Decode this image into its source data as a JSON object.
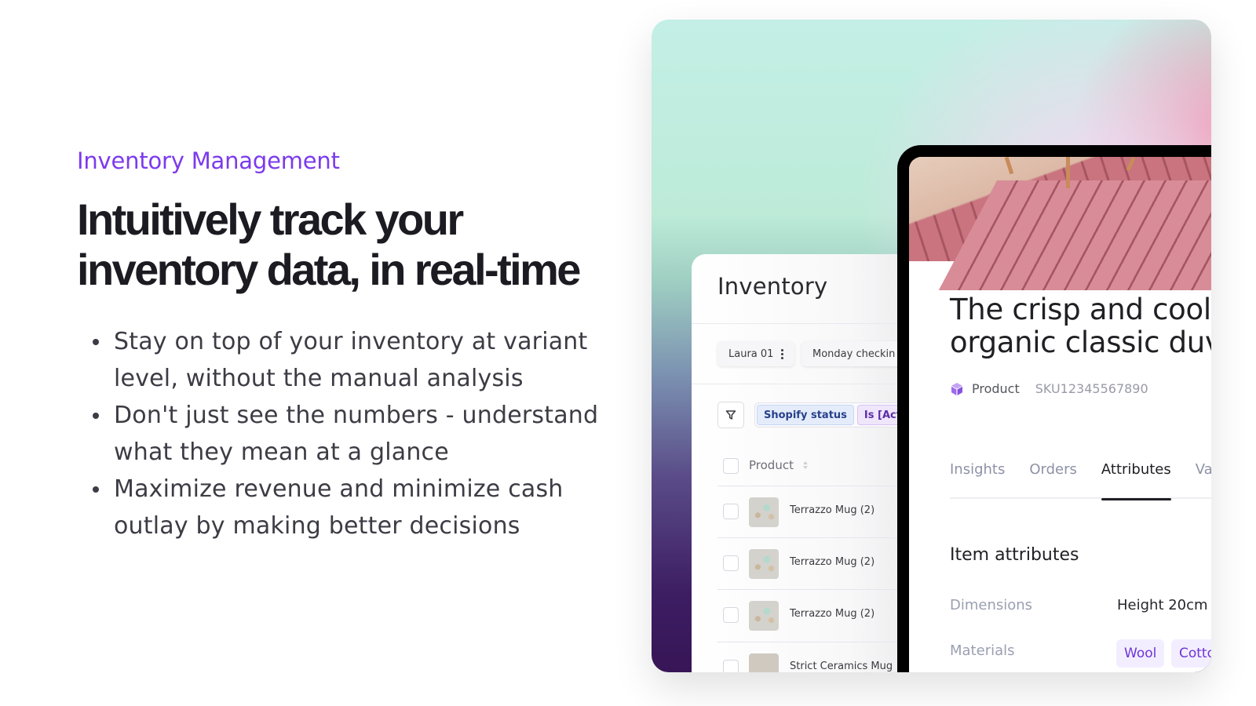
{
  "hero": {
    "eyebrow": "Inventory Management",
    "headline_line1": "Intuitively track your",
    "headline_line2": "inventory data, in real-time",
    "bullets": [
      {
        "line1": "Stay on top of your inventory at variant",
        "line2": "level, without the manual analysis"
      },
      {
        "line1": "Don't just see the numbers - understand",
        "line2": "what they mean at a glance"
      },
      {
        "line1": "Maximize revenue and minimize cash",
        "line2": "outlay by making better decisions"
      }
    ]
  },
  "colors": {
    "accent": "#7c3aed",
    "headline": "#1c1b22",
    "body": "#3d3c45",
    "tag_bg": "#f3eeff",
    "tag_text": "#6d35d6"
  },
  "inventory": {
    "title": "Inventory",
    "views": [
      {
        "label": "Laura 01",
        "icon": "kebab-menu-icon"
      },
      {
        "label": "Monday checkin"
      }
    ],
    "filter": {
      "icon": "filter-icon",
      "field": "Shopify status",
      "condition": "Is [Active]"
    },
    "column_header": "Product",
    "rows": [
      {
        "label": "Terrazzo Mug (2)"
      },
      {
        "label": "Terrazzo Mug (2)"
      },
      {
        "label": "Terrazzo Mug (2)"
      },
      {
        "label": "Strict Ceramics Mug"
      }
    ]
  },
  "product": {
    "title_line1": "The crisp and cool",
    "title_line2": "organic classic duv",
    "type_icon": "cube-icon",
    "type": "Product",
    "sku": "SKU12345567890",
    "tabs": [
      {
        "label": "Insights",
        "active": false
      },
      {
        "label": "Orders",
        "active": false
      },
      {
        "label": "Attributes",
        "active": true
      },
      {
        "label": "Va",
        "active": false
      }
    ],
    "section_title": "Item attributes",
    "attributes": {
      "dimensions_label": "Dimensions",
      "dimensions_value": "Height 20cm",
      "materials_label": "Materials",
      "materials": [
        "Wool",
        "Cotto"
      ]
    }
  }
}
